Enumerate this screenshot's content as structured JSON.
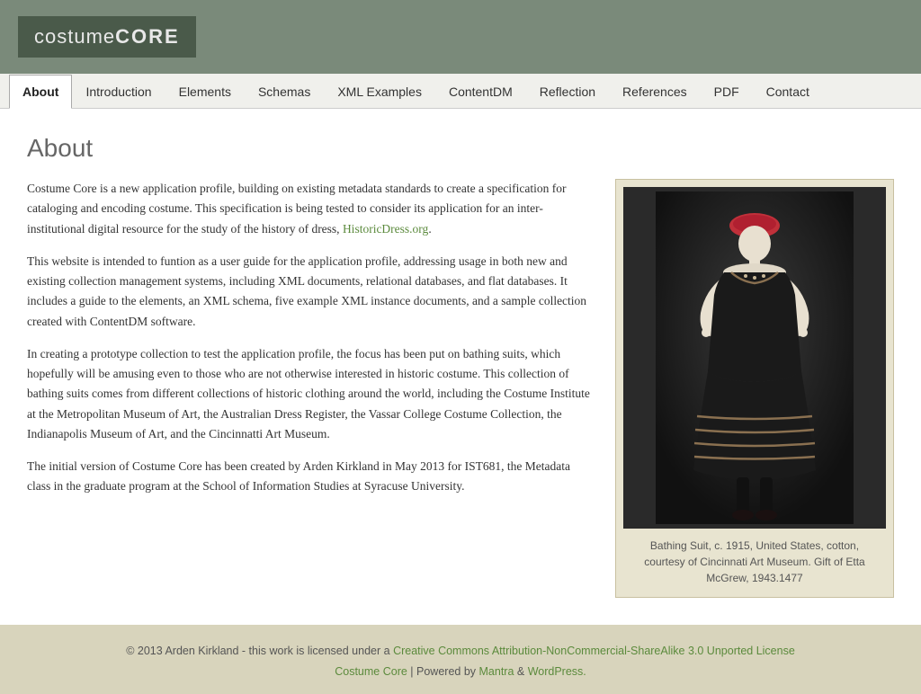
{
  "logo": {
    "costume": "costume",
    "core": "CORE"
  },
  "nav": {
    "tabs": [
      {
        "label": "About",
        "active": true
      },
      {
        "label": "Introduction",
        "active": false
      },
      {
        "label": "Elements",
        "active": false
      },
      {
        "label": "Schemas",
        "active": false
      },
      {
        "label": "XML Examples",
        "active": false
      },
      {
        "label": "ContentDM",
        "active": false
      },
      {
        "label": "Reflection",
        "active": false
      },
      {
        "label": "References",
        "active": false
      },
      {
        "label": "PDF",
        "active": false
      },
      {
        "label": "Contact",
        "active": false
      }
    ]
  },
  "page": {
    "title": "About",
    "paragraphs": [
      "Costume Core is a new application profile, building on existing metadata standards to create a specification for cataloging and encoding costume. This specification is being tested to consider its application for an inter-institutional digital resource for the study of the history of dress, HistoricDress.org.",
      "This website is intended to funtion as  a user guide for the application profile, addressing usage in both new and existing collection management systems, including XML documents, relational databases, and flat databases. It includes a guide to the elements, an XML schema, five example XML instance documents, and a sample collection created with ContentDM software.",
      "In creating a prototype collection to test the application profile, the focus has been put on bathing suits, which hopefully will be amusing even to those who are not otherwise interested in historic costume. This collection of bathing suits comes from different collections of historic clothing around the world, including the Costume Institute at the Metropolitan Museum of Art, the Australian Dress Register, the Vassar College Costume Collection, the Indianapolis Museum of Art, and the Cincinnatti Art Museum.",
      "The initial version of Costume Core has been created by Arden Kirkland in May 2013 for IST681, the Metadata class in the graduate program at the School of Information Studies at Syracuse University."
    ],
    "link_text": "HistoricDress.org",
    "image_caption": "Bathing Suit, c. 1915, United States, cotton, courtesy of Cincinnati Art Museum. Gift of Etta McGrew, 1943.1477"
  },
  "footer": {
    "copyright": "© 2013 Arden Kirkland - this work is licensed under a",
    "license_link": "Creative Commons Attribution-NonCommercial-ShareAlike 3.0 Unported License",
    "powered_by_prefix": "Costume Core",
    "powered_by_middle": "| Powered by",
    "mantra_link": "Mantra",
    "and_text": "&",
    "wordpress_link": "WordPress."
  }
}
